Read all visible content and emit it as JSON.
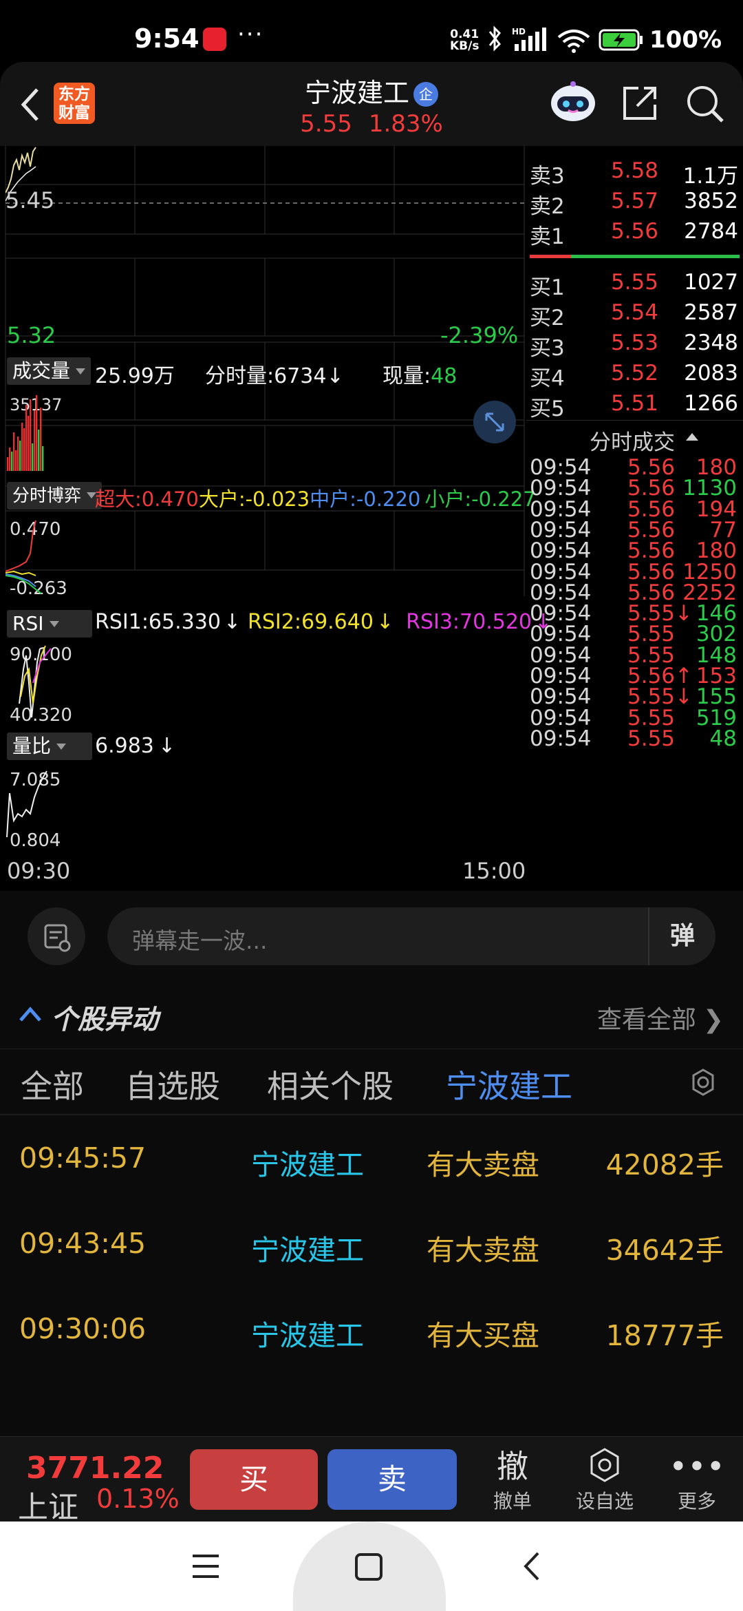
{
  "status_bar": {
    "time": "9:54",
    "more": "···",
    "net_speed": "0.41",
    "net_unit": "KB/s",
    "battery": "100%"
  },
  "header": {
    "logo_line1": "东方",
    "logo_line2": "财富",
    "stock_name": "宁波建工",
    "stock_badge": "企",
    "price": "5.55",
    "change_pct": "1.83%"
  },
  "price_chart": {
    "y_mid": "5.45",
    "y_low": "5.32",
    "low_pct": "-2.39%",
    "x_start": "09:30",
    "x_end": "15:00",
    "line_color": "#e8dca0"
  },
  "volume_panel": {
    "tag": "成交量",
    "total": "25.99万",
    "minute_vol_label": "分时量:",
    "minute_vol": "6734",
    "minute_vol_arrow": "↓",
    "current_label": "现量:",
    "current": "48",
    "max_tick": "35137"
  },
  "fund_panel": {
    "tag": "分时博弈",
    "super_label": "超大:",
    "super_val": "0.470",
    "large_label": "大户:",
    "large_val": "-0.023",
    "mid_label": "中户:",
    "mid_val": "-0.220",
    "small_label": "小户:",
    "small_val": "-0.227",
    "axis_max": "0.470",
    "axis_min": "-0.263"
  },
  "rsi_panel": {
    "tag": "RSI",
    "rsi1": "RSI1:65.330",
    "rsi1_arrow": "↓",
    "rsi2": "RSI2:69.640",
    "rsi2_arrow": "↓",
    "rsi3": "RSI3:70.520",
    "rsi3_arrow": "↓",
    "axis_max": "90.100",
    "axis_min": "40.320"
  },
  "ratio_panel": {
    "tag": "量比",
    "value": "6.983",
    "arrow": "↓",
    "axis_max": "7.085",
    "axis_min": "0.804"
  },
  "order_book": {
    "asks": [
      {
        "label": "卖3",
        "price": "5.58",
        "vol": "1.1万"
      },
      {
        "label": "卖2",
        "price": "5.57",
        "vol": "3852"
      },
      {
        "label": "卖1",
        "price": "5.56",
        "vol": "2784"
      }
    ],
    "bids": [
      {
        "label": "买1",
        "price": "5.55",
        "vol": "1027"
      },
      {
        "label": "买2",
        "price": "5.54",
        "vol": "2587"
      },
      {
        "label": "买3",
        "price": "5.53",
        "vol": "2348"
      },
      {
        "label": "买4",
        "price": "5.52",
        "vol": "2083"
      },
      {
        "label": "买5",
        "price": "5.51",
        "vol": "1266"
      }
    ]
  },
  "ticks": {
    "title": "分时成交",
    "rows": [
      {
        "time": "09:54",
        "price": "5.56",
        "vol": "180",
        "vol_color": "red"
      },
      {
        "time": "09:54",
        "price": "5.56",
        "vol": "1130",
        "vol_color": "green"
      },
      {
        "time": "09:54",
        "price": "5.56",
        "vol": "194",
        "vol_color": "red"
      },
      {
        "time": "09:54",
        "price": "5.56",
        "vol": "77",
        "vol_color": "red"
      },
      {
        "time": "09:54",
        "price": "5.56",
        "vol": "180",
        "vol_color": "red"
      },
      {
        "time": "09:54",
        "price": "5.56",
        "vol": "1250",
        "vol_color": "red"
      },
      {
        "time": "09:54",
        "price": "5.56",
        "vol": "2252",
        "vol_color": "red"
      },
      {
        "time": "09:54",
        "price": "5.55↓",
        "vol": "146",
        "vol_color": "green"
      },
      {
        "time": "09:54",
        "price": "5.55",
        "vol": "302",
        "vol_color": "green"
      },
      {
        "time": "09:54",
        "price": "5.55",
        "vol": "148",
        "vol_color": "green"
      },
      {
        "time": "09:54",
        "price": "5.56↑",
        "vol": "153",
        "vol_color": "red"
      },
      {
        "time": "09:54",
        "price": "5.55↓",
        "vol": "155",
        "vol_color": "green"
      },
      {
        "time": "09:54",
        "price": "5.55",
        "vol": "519",
        "vol_color": "green"
      },
      {
        "time": "09:54",
        "price": "5.55",
        "vol": "48",
        "vol_color": "green"
      }
    ]
  },
  "danmu": {
    "placeholder": "弹幕走一波...",
    "send": "弹"
  },
  "movers": {
    "title": "个股异动",
    "see_all": "查看全部",
    "tabs": [
      "全部",
      "自选股",
      "相关个股",
      "宁波建工"
    ],
    "rows": [
      {
        "time": "09:45:57",
        "name": "宁波建工",
        "event": "有大卖盘",
        "vol": "42082手"
      },
      {
        "time": "09:43:45",
        "name": "宁波建工",
        "event": "有大卖盘",
        "vol": "34642手"
      },
      {
        "time": "09:30:06",
        "name": "宁波建工",
        "event": "有大买盘",
        "vol": "18777手"
      }
    ]
  },
  "trade_bar": {
    "index_value": "3771.22",
    "index_name": "上证",
    "index_pct": "0.13%",
    "buy": "买",
    "sell": "卖",
    "cancel_big": "撤",
    "cancel": "撤单",
    "watch": "设自选",
    "more": "更多"
  }
}
